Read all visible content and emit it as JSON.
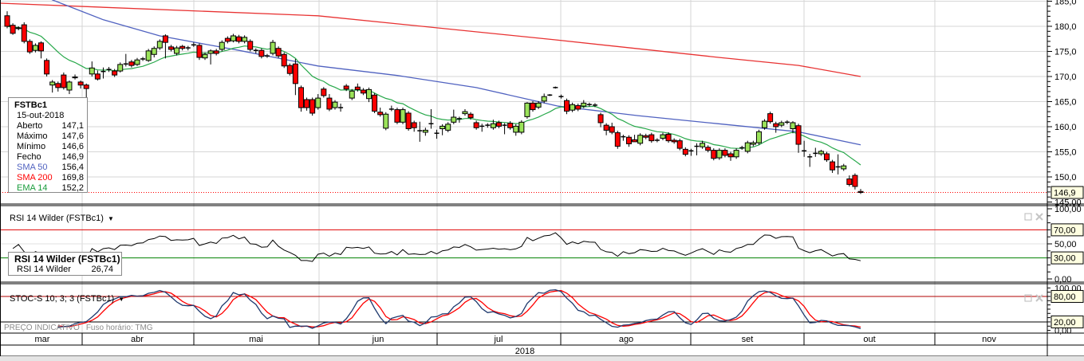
{
  "instrument": "FSTBc1",
  "legend": {
    "title": "FSTBc1",
    "date": "15-out-2018",
    "rows": [
      {
        "label": "Aberto",
        "value": "147,1"
      },
      {
        "label": "Máximo",
        "value": "147,6"
      },
      {
        "label": "Mínimo",
        "value": "146,6"
      },
      {
        "label": "Fecho",
        "value": "146,9"
      },
      {
        "label": "SMA 50",
        "value": "156,4"
      },
      {
        "label": "SMA 200",
        "value": "169,8"
      },
      {
        "label": "EMA 14",
        "value": "152,2"
      }
    ]
  },
  "price_axis": {
    "labels": [
      {
        "value": 185,
        "text": "185,0"
      },
      {
        "value": 180,
        "text": "180,0"
      },
      {
        "value": 175,
        "text": "175,0"
      },
      {
        "value": 170,
        "text": "170,0"
      },
      {
        "value": 165,
        "text": "165,0"
      },
      {
        "value": 160,
        "text": "160,0"
      },
      {
        "value": 155,
        "text": "155,0"
      },
      {
        "value": 150,
        "text": "150,0"
      },
      {
        "value": 145,
        "text": "145,00"
      }
    ],
    "last_price": {
      "value": 146.9,
      "text": "146,9"
    }
  },
  "rsi": {
    "title": "RSI 14 Wilder (FSTBc1)",
    "legend_title": "RSI 14 Wilder (FSTBc1)",
    "legend_label": "RSI 14 Wilder",
    "legend_value": "26,74",
    "axis_labels": [
      {
        "value": 100,
        "text": "100,00"
      },
      {
        "value": 50,
        "text": "50,00"
      },
      {
        "value": 0,
        "text": "0,00"
      }
    ],
    "upper": {
      "value": 70,
      "text": "70,00"
    },
    "lower": {
      "value": 30,
      "text": "30,00"
    }
  },
  "stoch": {
    "title": "STOC-S 10; 3; 3 (FSTBc1)",
    "axis_labels": [
      {
        "value": 100,
        "text": "100,00"
      },
      {
        "value": 0,
        "text": "0,00"
      }
    ],
    "upper": {
      "value": 80,
      "text": "80,00"
    },
    "lower": {
      "value": 20,
      "text": "20,00"
    }
  },
  "footer": {
    "price_note": "PREÇO INDICATIVO",
    "timezone": "Fuso horário: TMG"
  },
  "time_axis": {
    "months": [
      "mar",
      "abr",
      "mai",
      "jun",
      "jul",
      "ago",
      "set",
      "out",
      "nov"
    ],
    "year": "2018"
  },
  "colors": {
    "up_candle": "#9be35a",
    "down_candle": "#ff0000",
    "sma50": "#5062c0",
    "sma200": "#e83232",
    "ema14": "#27a84a",
    "rsi_line": "#000000",
    "rsi_upper": "#e00000",
    "rsi_lower": "#008000",
    "stoch_k": "#1f3a6e",
    "stoch_d": "#ff0000",
    "last_price_line": "#ff0000"
  },
  "chart_data": {
    "type": "candlestick",
    "title": "FSTBc1",
    "period": "mar–out 2018, daily",
    "ylim": [
      145,
      185
    ],
    "ohlc_fields": [
      "open",
      "high",
      "low",
      "close"
    ],
    "ohlc": [
      [
        182.1,
        183.0,
        179.6,
        180.0
      ],
      [
        180.2,
        180.6,
        178.3,
        178.6
      ],
      [
        179.6,
        180.0,
        179.2,
        179.7
      ],
      [
        180.3,
        180.8,
        176.6,
        177.0
      ],
      [
        177.0,
        177.4,
        174.5,
        174.9
      ],
      [
        175.2,
        176.6,
        174.8,
        176.2
      ],
      [
        176.7,
        177.0,
        173.6,
        175.1
      ],
      [
        173.2,
        173.6,
        170.0,
        170.5
      ],
      [
        168.3,
        169.3,
        166.8,
        168.9
      ],
      [
        168.6,
        169.0,
        167.0,
        167.8
      ],
      [
        170.3,
        170.8,
        167.4,
        167.8
      ],
      [
        167.3,
        169.2,
        166.5,
        168.9
      ],
      [
        169.8,
        170.4,
        169.4,
        169.9
      ],
      [
        168.9,
        169.2,
        167.6,
        168.3
      ],
      [
        168.3,
        168.6,
        165.0,
        167.6
      ],
      [
        170.5,
        173.0,
        170.0,
        171.7
      ],
      [
        170.5,
        171.2,
        169.2,
        169.5
      ],
      [
        171.0,
        171.8,
        169.6,
        171.0
      ],
      [
        171.4,
        171.9,
        170.9,
        171.4
      ],
      [
        171.1,
        171.5,
        169.9,
        170.3
      ],
      [
        171.1,
        172.8,
        170.8,
        172.4
      ],
      [
        172.5,
        174.5,
        172.0,
        172.5
      ],
      [
        172.9,
        173.3,
        171.8,
        172.2
      ],
      [
        172.4,
        173.7,
        172.1,
        173.3
      ],
      [
        173.5,
        173.9,
        173.1,
        173.5
      ],
      [
        173.2,
        175.5,
        172.9,
        175.1
      ],
      [
        174.4,
        176.0,
        173.8,
        175.6
      ],
      [
        175.7,
        177.4,
        175.3,
        177.0
      ],
      [
        178.1,
        178.4,
        173.6,
        176.8
      ],
      [
        175.9,
        176.3,
        175.0,
        175.4
      ],
      [
        174.6,
        176.1,
        174.2,
        175.7
      ],
      [
        176.0,
        176.3,
        175.2,
        175.6
      ],
      [
        175.7,
        176.1,
        175.2,
        175.7
      ],
      [
        176.3,
        176.8,
        175.9,
        176.3
      ],
      [
        176.2,
        176.6,
        173.3,
        173.8
      ],
      [
        173.7,
        174.8,
        173.3,
        174.4
      ],
      [
        174.6,
        175.4,
        172.4,
        175.1
      ],
      [
        175.1,
        175.5,
        174.2,
        174.6
      ],
      [
        175.4,
        177.2,
        175.0,
        176.8
      ],
      [
        177.6,
        178.0,
        176.6,
        177.0
      ],
      [
        177.1,
        178.5,
        176.8,
        178.1
      ],
      [
        177.9,
        178.3,
        176.6,
        177.0
      ],
      [
        177.0,
        178.2,
        176.6,
        177.8
      ],
      [
        177.0,
        177.4,
        175.0,
        175.4
      ],
      [
        175.2,
        175.6,
        174.6,
        175.2
      ],
      [
        175.2,
        175.6,
        173.6,
        174.0
      ],
      [
        174.1,
        174.5,
        173.7,
        174.1
      ],
      [
        174.6,
        177.3,
        174.2,
        176.8
      ],
      [
        175.6,
        176.0,
        173.7,
        174.1
      ],
      [
        174.4,
        174.8,
        171.7,
        172.1
      ],
      [
        172.2,
        172.6,
        170.2,
        170.6
      ],
      [
        172.5,
        173.5,
        166.3,
        168.6
      ],
      [
        167.8,
        168.2,
        163.0,
        163.8
      ],
      [
        165.4,
        165.8,
        163.2,
        163.8
      ],
      [
        165.4,
        165.8,
        162.2,
        162.7
      ],
      [
        163.8,
        166.5,
        163.4,
        165.7
      ],
      [
        167.5,
        167.9,
        165.8,
        166.2
      ],
      [
        165.7,
        166.5,
        163.1,
        163.5
      ],
      [
        163.8,
        165.3,
        163.4,
        164.9
      ],
      [
        163.8,
        164.6,
        163.0,
        163.8
      ],
      [
        168.1,
        168.5,
        167.1,
        167.5
      ],
      [
        165.7,
        167.5,
        165.3,
        167.1
      ],
      [
        167.9,
        168.6,
        167.0,
        167.4
      ],
      [
        167.3,
        167.7,
        166.3,
        166.7
      ],
      [
        165.6,
        167.8,
        164.9,
        167.4
      ],
      [
        166.3,
        166.7,
        162.7,
        163.1
      ],
      [
        162.9,
        163.8,
        162.0,
        162.4
      ],
      [
        159.7,
        162.9,
        159.3,
        162.5
      ],
      [
        163.5,
        164.2,
        163.1,
        163.5
      ],
      [
        163.4,
        163.8,
        160.5,
        160.9
      ],
      [
        160.9,
        163.8,
        160.5,
        163.4
      ],
      [
        162.7,
        163.1,
        159.2,
        159.6
      ],
      [
        160.8,
        161.2,
        159.0,
        159.8
      ],
      [
        159.2,
        161.0,
        157.0,
        159.2
      ],
      [
        158.9,
        159.8,
        158.2,
        159.3
      ],
      [
        160.6,
        163.5,
        159.6,
        160.6
      ],
      [
        158.7,
        159.4,
        157.6,
        158.7
      ],
      [
        159.6,
        160.5,
        158.3,
        160.1
      ],
      [
        159.3,
        160.9,
        158.9,
        160.5
      ],
      [
        160.9,
        163.4,
        160.5,
        161.9
      ],
      [
        161.6,
        162.0,
        160.8,
        161.6
      ],
      [
        162.6,
        163.5,
        162.2,
        163.0
      ],
      [
        162.5,
        162.9,
        161.4,
        161.8
      ],
      [
        160.8,
        161.2,
        159.4,
        159.8
      ],
      [
        160.1,
        160.6,
        159.0,
        160.1
      ],
      [
        160.3,
        160.7,
        159.8,
        160.3
      ],
      [
        159.8,
        161.4,
        159.4,
        160.6
      ],
      [
        160.8,
        161.2,
        159.7,
        160.1
      ],
      [
        160.3,
        160.7,
        158.5,
        160.3
      ],
      [
        160.7,
        161.1,
        159.4,
        159.8
      ],
      [
        158.9,
        160.5,
        158.2,
        160.1
      ],
      [
        158.9,
        161.3,
        158.5,
        160.9
      ],
      [
        162.0,
        164.9,
        161.6,
        164.7
      ],
      [
        164.7,
        165.1,
        163.0,
        163.4
      ],
      [
        163.9,
        165.1,
        163.5,
        164.7
      ],
      [
        165.1,
        166.6,
        164.7,
        166.0
      ],
      [
        166.3,
        166.5,
        166.1,
        166.3
      ],
      [
        167.8,
        168.0,
        167.6,
        167.8
      ],
      [
        166.0,
        166.4,
        165.6,
        166.0
      ],
      [
        165.2,
        165.6,
        162.5,
        163.1
      ],
      [
        163.3,
        164.8,
        162.9,
        164.4
      ],
      [
        164.2,
        164.6,
        163.1,
        163.5
      ],
      [
        164.1,
        165.3,
        163.7,
        164.7
      ],
      [
        164.4,
        164.8,
        164.0,
        164.4
      ],
      [
        164.3,
        164.7,
        163.9,
        164.3
      ],
      [
        162.4,
        162.8,
        159.9,
        160.8
      ],
      [
        160.3,
        160.7,
        158.3,
        159.3
      ],
      [
        160.0,
        160.8,
        158.5,
        158.9
      ],
      [
        158.8,
        159.2,
        155.6,
        156.1
      ],
      [
        158.0,
        158.4,
        157.2,
        158.0
      ],
      [
        157.9,
        158.3,
        156.0,
        156.6
      ],
      [
        157.4,
        158.4,
        157.0,
        157.0
      ],
      [
        156.7,
        158.7,
        156.3,
        158.3
      ],
      [
        158.2,
        158.6,
        157.5,
        157.9
      ],
      [
        158.4,
        158.8,
        156.8,
        157.2
      ],
      [
        157.3,
        157.7,
        156.9,
        157.3
      ],
      [
        157.7,
        158.8,
        157.3,
        158.4
      ],
      [
        158.5,
        158.9,
        156.8,
        157.2
      ],
      [
        157.3,
        157.7,
        156.6,
        157.0
      ],
      [
        157.2,
        157.6,
        155.3,
        155.7
      ],
      [
        155.5,
        155.9,
        154.1,
        154.5
      ],
      [
        155.2,
        155.6,
        154.2,
        155.2
      ],
      [
        156.1,
        156.7,
        154.3,
        156.1
      ],
      [
        156.0,
        157.2,
        155.6,
        156.7
      ],
      [
        155.9,
        156.3,
        154.9,
        155.3
      ],
      [
        155.3,
        155.7,
        153.3,
        153.7
      ],
      [
        153.8,
        155.7,
        153.4,
        155.3
      ],
      [
        155.3,
        155.7,
        153.9,
        154.3
      ],
      [
        154.6,
        155.0,
        153.2,
        154.0
      ],
      [
        154.0,
        155.7,
        153.6,
        155.3
      ],
      [
        155.8,
        156.2,
        155.4,
        155.8
      ],
      [
        155.1,
        157.2,
        154.7,
        156.8
      ],
      [
        156.5,
        157.2,
        156.1,
        156.8
      ],
      [
        156.8,
        159.4,
        156.4,
        159.0
      ],
      [
        159.8,
        161.5,
        159.4,
        161.1
      ],
      [
        162.6,
        163.0,
        160.6,
        161.0
      ],
      [
        160.6,
        161.0,
        158.8,
        160.0
      ],
      [
        160.3,
        161.2,
        159.9,
        160.8
      ],
      [
        160.9,
        161.3,
        160.5,
        160.9
      ],
      [
        159.6,
        161.1,
        158.7,
        160.8
      ],
      [
        160.2,
        160.6,
        154.8,
        156.5
      ],
      [
        155.2,
        157.2,
        154.0,
        155.2
      ],
      [
        154.0,
        154.6,
        152.0,
        154.0
      ],
      [
        154.7,
        155.8,
        154.0,
        154.7
      ],
      [
        154.6,
        155.4,
        154.2,
        155.1
      ],
      [
        154.6,
        155.0,
        153.0,
        153.4
      ],
      [
        153.0,
        153.4,
        150.8,
        151.4
      ],
      [
        152.0,
        154.5,
        150.5,
        152.0
      ],
      [
        151.6,
        152.6,
        151.2,
        152.2
      ],
      [
        149.6,
        150.3,
        148.1,
        148.5
      ],
      [
        150.3,
        150.7,
        147.5,
        148.1
      ],
      [
        147.1,
        147.6,
        146.6,
        146.9
      ]
    ],
    "sma50_points": [
      [
        7.9,
        185.3
      ],
      [
        17,
        181.3
      ],
      [
        27,
        178.1
      ],
      [
        41,
        175.2
      ],
      [
        55,
        172.1
      ],
      [
        69,
        170.2
      ],
      [
        83,
        167.8
      ],
      [
        97.5,
        164.1
      ],
      [
        111.6,
        162.2
      ],
      [
        125.7,
        160.6
      ],
      [
        139.9,
        159.0
      ],
      [
        151,
        156.4
      ]
    ],
    "sma200_points": [
      [
        -1.3,
        184.6
      ],
      [
        55,
        182.1
      ],
      [
        97,
        177.3
      ],
      [
        126,
        173.8
      ],
      [
        140,
        172.2
      ],
      [
        151,
        170.0
      ]
    ],
    "ema_period": 14,
    "rsi_period": 14,
    "stoch_params": [
      10,
      3,
      3
    ],
    "rsi_levels": [
      70,
      30
    ],
    "stoch_levels": [
      80,
      20
    ],
    "rsi_last": 26.74
  }
}
